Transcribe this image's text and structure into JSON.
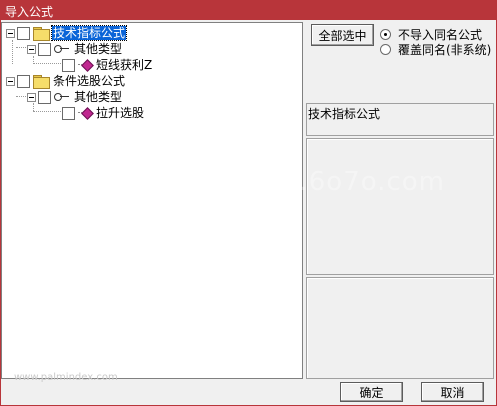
{
  "window": {
    "title": "导入公式"
  },
  "tree": {
    "nodes": [
      {
        "label": "技术指标公式",
        "selected": true
      },
      {
        "label": "其他类型"
      },
      {
        "label": "短线获利Z"
      },
      {
        "label": "条件选股公式"
      },
      {
        "label": "其他类型"
      },
      {
        "label": "拉升选股"
      }
    ]
  },
  "options": {
    "select_all_label": "全部选中",
    "radio_no_import": "不导入同名公式",
    "radio_overwrite": "覆盖同名(非系统)",
    "selected_radio": "no_import"
  },
  "info": {
    "category": "技术指标公式"
  },
  "footer": {
    "ok_label": "确定",
    "cancel_label": "取消"
  },
  "watermark": {
    "center_text": "u.6o7o.com",
    "bottom_text": "www.palmindex.com"
  },
  "colors": {
    "titlebar": "#b8353a",
    "selection": "#0a64d8",
    "folder": "#f6dd6a",
    "gem": "#c02890"
  }
}
